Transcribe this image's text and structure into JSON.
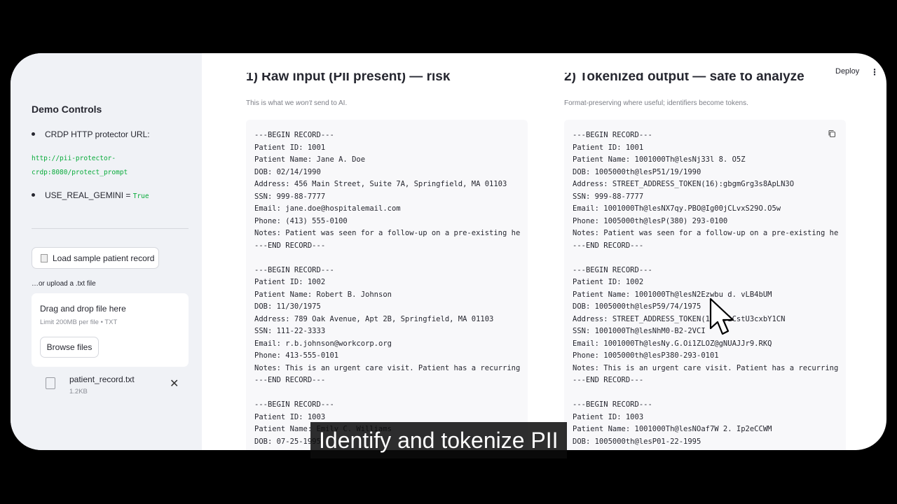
{
  "sidebar": {
    "title": "Demo Controls",
    "protector_label": "CRDP HTTP protector URL:",
    "protector_url_line1": "http://pii-protector-",
    "protector_url_line2": "crdp:8080/protect_prompt",
    "gemini_label": "USE_REAL_GEMINI = ",
    "gemini_value": "True",
    "load_button": "Load sample patient record",
    "upload_label": "…or upload a .txt file",
    "dropzone_title": "Drag and drop file here",
    "dropzone_subtitle": "Limit 200MB per file • TXT",
    "browse_button": "Browse files",
    "file_name": "patient_record.txt",
    "file_size": "1.2KB"
  },
  "header": {
    "deploy": "Deploy",
    "menu_icon": "⋮"
  },
  "left_column": {
    "heading": "1) Raw input (PII present) — risk",
    "caption_pre": "This is what we ",
    "caption_em": "won't",
    "caption_post": " send to AI.",
    "text": "---BEGIN RECORD---\nPatient ID: 1001\nPatient Name: Jane A. Doe\nDOB: 02/14/1990\nAddress: 456 Main Street, Suite 7A, Springfield, MA 01103\nSSN: 999-88-7777\nEmail: jane.doe@hospitalemail.com\nPhone: (413) 555-0100\nNotes: Patient was seen for a follow-up on a pre-existing he\n---END RECORD---\n\n---BEGIN RECORD---\nPatient ID: 1002\nPatient Name: Robert B. Johnson\nDOB: 11/30/1975\nAddress: 789 Oak Avenue, Apt 2B, Springfield, MA 01103\nSSN: 111-22-3333\nEmail: r.b.johnson@workcorp.org\nPhone: 413-555-0101\nNotes: This is an urgent care visit. Patient has a recurring\n---END RECORD---\n\n---BEGIN RECORD---\nPatient ID: 1003\nPatient Name: Emily C. Williams\nDOB: 07-25-1995"
  },
  "right_column": {
    "heading": "2) Tokenized output — safe to analyze",
    "caption": "Format-preserving where useful; identifiers become tokens.",
    "text": "---BEGIN RECORD---\nPatient ID: 1001\nPatient Name: 1001000Th@lesNj33l 8. O5Z\nDOB: 1005000th@lesP51/19/1990\nAddress: STREET_ADDRESS_TOKEN(16):gbgmGrg3s8ApLN3O\nSSN: 999-88-7777\nEmail: 1001000Th@lesNX7qy.PBO@Ig00jCLvxS29O.O5w\nPhone: 1005000th@lesP(380) 293-0100\nNotes: Patient was seen for a follow-up on a pre-existing he\n---END RECORD---\n\n---BEGIN RECORD---\nPatient ID: 1002\nPatient Name: 1001000Th@lesN2Ezwbu d. vLB4bUM\nDOB: 1005000th@lesP59/74/1975\nAddress: STREET_ADDRESS_TOKEN(16):TiCstU3cxbY1CN\nSSN: 1001000Th@lesNhM0-B2-2VCI\nEmail: 1001000Th@lesNy.G.Oi1ZLOZ@gNUAJJr9.RKQ\nPhone: 1005000th@lesP380-293-0101\nNotes: This is an urgent care visit. Patient has a recurring\n---END RECORD---\n\n---BEGIN RECORD---\nPatient ID: 1003\nPatient Name: 1001000Th@lesNOaf7W 2. Ip2eCCWM\nDOB: 1005000th@lesP01-22-1995"
  },
  "overlay": {
    "subtitle": "Identify and tokenize PII"
  },
  "colors": {
    "sidebar_bg": "#f0f2f6",
    "code_bg": "#f8f8fa",
    "green_code": "#09ab3b"
  }
}
